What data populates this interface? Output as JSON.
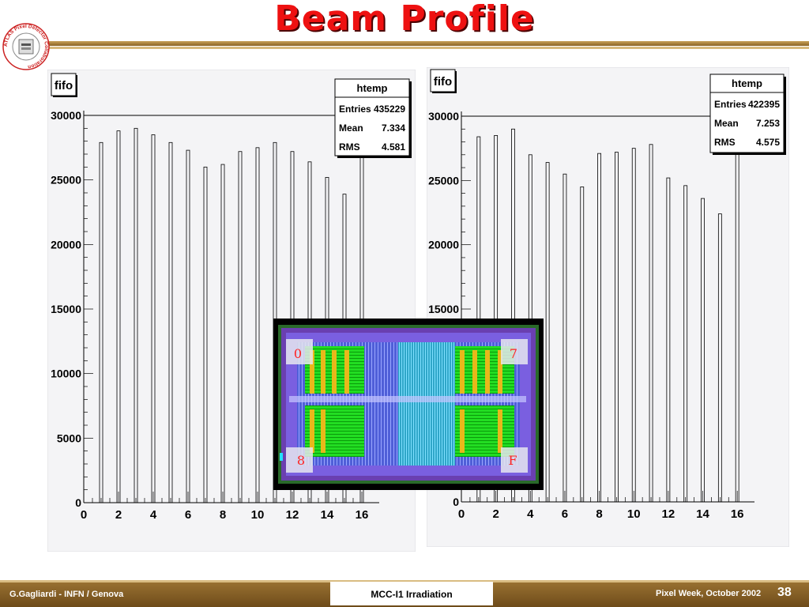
{
  "slide": {
    "title": "Beam Profile",
    "footer_left": "G.Gagliardi - INFN / Genova",
    "footer_center": "MCC-I1 Irradiation",
    "footer_right": "Pixel Week, October 2002",
    "page_number": "38",
    "logo_text": "ATLAS Pixel Detector Collaboration"
  },
  "chip_image": {
    "corner_labels": [
      "0",
      "7",
      "8",
      "F"
    ]
  },
  "chart_data": [
    {
      "type": "bar",
      "title": "fifo",
      "x": [
        1,
        2,
        3,
        4,
        5,
        6,
        7,
        8,
        9,
        10,
        11,
        12,
        13,
        14,
        15,
        16
      ],
      "values": [
        27900,
        28800,
        29000,
        28500,
        27900,
        27300,
        26000,
        26200,
        27200,
        27500,
        27900,
        27200,
        26400,
        25200,
        23900,
        28800
      ],
      "xlim": [
        0,
        17
      ],
      "ylim": [
        0,
        30000
      ],
      "xticks": [
        "0",
        "2",
        "4",
        "6",
        "8",
        "10",
        "12",
        "14",
        "16"
      ],
      "yticks": [
        "0",
        "5000",
        "10000",
        "15000",
        "20000",
        "25000",
        "30000"
      ],
      "stats": {
        "name": "htemp",
        "rows": [
          {
            "label": "Entries",
            "value": "435229"
          },
          {
            "label": "Mean",
            "value": "7.334"
          },
          {
            "label": "RMS",
            "value": "4.581"
          }
        ]
      }
    },
    {
      "type": "bar",
      "title": "fifo",
      "x": [
        1,
        2,
        3,
        4,
        5,
        6,
        7,
        8,
        9,
        10,
        11,
        12,
        13,
        14,
        15,
        16
      ],
      "values": [
        28400,
        28500,
        29000,
        27000,
        26400,
        25500,
        24500,
        27100,
        27200,
        27500,
        27800,
        25200,
        24600,
        23600,
        22400,
        29500
      ],
      "xlim": [
        0,
        17
      ],
      "ylim": [
        0,
        30000
      ],
      "xticks": [
        "0",
        "2",
        "4",
        "6",
        "8",
        "10",
        "12",
        "14",
        "16"
      ],
      "yticks": [
        "0",
        "5000",
        "10000",
        "15000",
        "20000",
        "25000",
        "30000"
      ],
      "stats": {
        "name": "htemp",
        "rows": [
          {
            "label": "Entries",
            "value": "422395"
          },
          {
            "label": "Mean",
            "value": "7.253"
          },
          {
            "label": "RMS",
            "value": "4.575"
          }
        ]
      }
    }
  ]
}
